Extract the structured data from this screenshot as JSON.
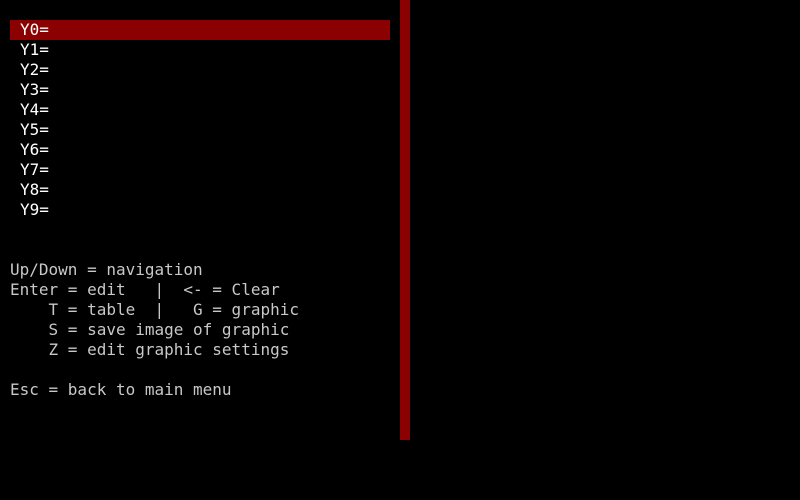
{
  "equations": [
    {
      "label": "Y0="
    },
    {
      "label": "Y1="
    },
    {
      "label": "Y2="
    },
    {
      "label": "Y3="
    },
    {
      "label": "Y4="
    },
    {
      "label": "Y5="
    },
    {
      "label": "Y6="
    },
    {
      "label": "Y7="
    },
    {
      "label": "Y8="
    },
    {
      "label": "Y9="
    }
  ],
  "selected_index": 0,
  "help": {
    "line1": "Up/Down = navigation",
    "line2": "Enter = edit   |  <- = Clear",
    "line3": "    T = table  |   G = graphic",
    "line4": "    S = save image of graphic",
    "line5": "    Z = edit graphic settings",
    "line6": "",
    "line7": "Esc = back to main menu"
  },
  "colors": {
    "background": "#000000",
    "accent": "#8b0000",
    "equation_text": "#ffffff",
    "help_text": "#c8c8c8"
  }
}
